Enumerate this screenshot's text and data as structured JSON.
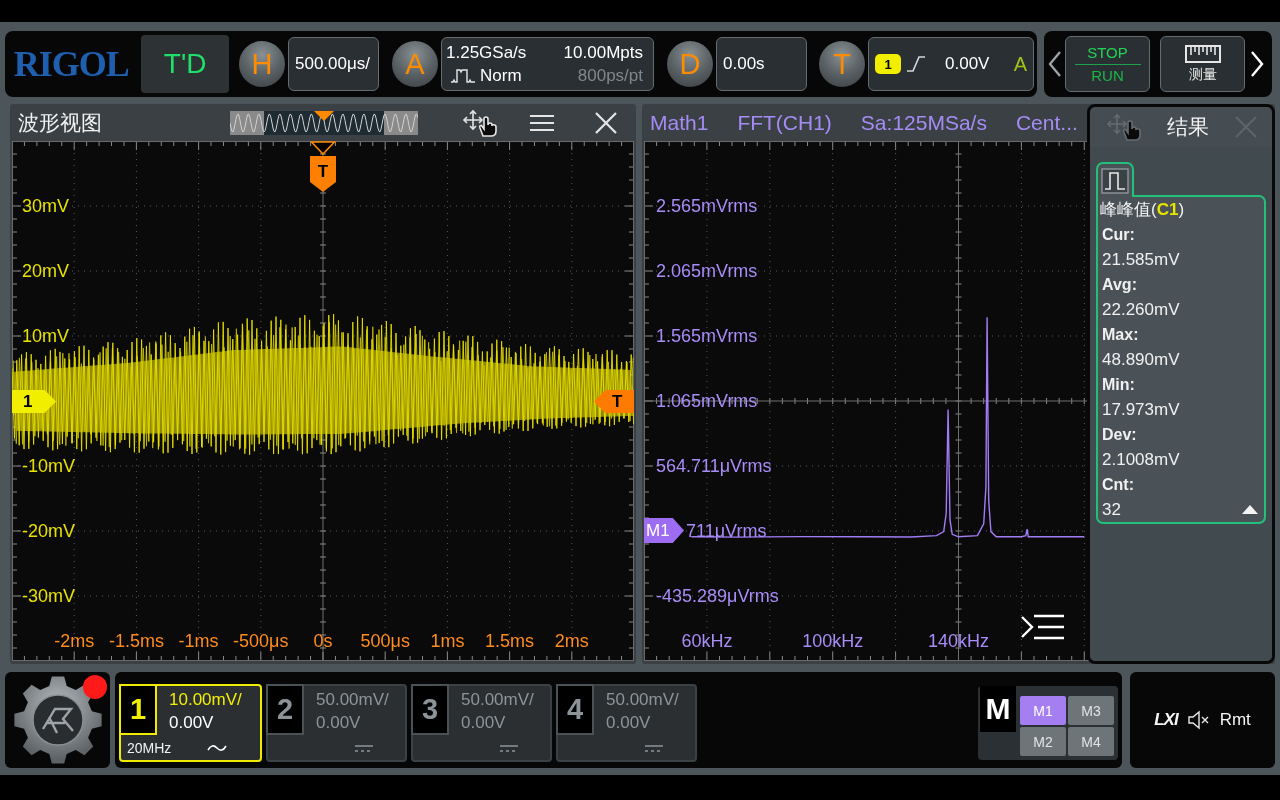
{
  "top_bar": {
    "logo": "RIGOL",
    "mode_button": "T'D",
    "horizontal": {
      "key": "H",
      "scale": "500.00μs/"
    },
    "acquire": {
      "key": "A",
      "sample_rate": "1.25GSa/s",
      "memory_depth": "10.00Mpts",
      "mode": "Norm",
      "resolution": "800ps/pt"
    },
    "delay": {
      "key": "D",
      "value": "0.00s"
    },
    "trigger": {
      "key": "T",
      "source": "1",
      "level": "0.00V",
      "sweep": "A"
    },
    "run_stop": {
      "stop": "STOP",
      "run": "RUN"
    },
    "measure_button": "测量"
  },
  "waveform_view": {
    "title": "波形视图",
    "y_labels_upper": [
      "30mV",
      "20mV",
      "10mV"
    ],
    "y_labels_lower": [
      "-10mV",
      "-20mV",
      "-30mV"
    ],
    "x_labels": [
      "-2ms",
      "-1.5ms",
      "-1ms",
      "-500μs",
      "0s",
      "500μs",
      "1ms",
      "1.5ms",
      "2ms"
    ],
    "channel_marker": "1",
    "trigger_position_marker": "T",
    "trigger_level_marker": "T"
  },
  "fft_view": {
    "header": [
      "Math1",
      "FFT(CH1)",
      "Sa:125MSa/s",
      "Cent..."
    ],
    "math_marker": "M1",
    "y_labels_microvolt": [
      "564.711μVrms",
      "711μVrms",
      "-435.289μVrms"
    ],
    "chart_data": {
      "type": "line",
      "x": [
        55,
        70,
        90,
        110,
        125,
        133,
        135.3,
        136.1,
        136.7,
        137.3,
        138,
        140,
        146,
        148,
        148.7,
        149.1,
        149.6,
        150.3,
        152,
        160,
        161.4,
        161.8,
        162.2,
        180
      ],
      "values": [
        0.02,
        0.018,
        0.022,
        0.02,
        0.019,
        0.03,
        0.06,
        0.2,
        1.0,
        0.15,
        0.04,
        0.02,
        0.03,
        0.12,
        0.4,
        1.71,
        0.3,
        0.06,
        0.02,
        0.02,
        0.03,
        0.08,
        0.02,
        0.02
      ],
      "xlim": [
        40,
        240
      ],
      "ylim": [
        -0.935,
        3.065
      ],
      "grid": true,
      "xticks": [
        {
          "value": 60,
          "label": "60kHz"
        },
        {
          "value": 100,
          "label": "100kHz"
        },
        {
          "value": 140,
          "label": "140kHz"
        }
      ],
      "yticks": [
        {
          "value": 2.565,
          "label": "2.565mVrms"
        },
        {
          "value": 2.065,
          "label": "2.065mVrms"
        },
        {
          "value": 1.565,
          "label": "1.565mVrms"
        },
        {
          "value": 1.065,
          "label": "1.065mVrms"
        }
      ]
    }
  },
  "results_panel": {
    "title": "结果",
    "measurement": "峰峰值(**C1**)",
    "stats": [
      {
        "label": "Cur:",
        "value": "21.585mV"
      },
      {
        "label": "Avg:",
        "value": "22.260mV"
      },
      {
        "label": "Max:",
        "value": "48.890mV"
      },
      {
        "label": "Min:",
        "value": "17.973mV"
      },
      {
        "label": "Dev:",
        "value": "2.1008mV"
      },
      {
        "label": "Cnt:",
        "value": "32"
      }
    ]
  },
  "bottom_bar": {
    "channels": [
      {
        "number": "1",
        "on": true,
        "kind": "ac",
        "scale": "10.00mV/",
        "offset": "0.00V",
        "bandwidth": "20MHz"
      },
      {
        "number": "2",
        "on": false,
        "kind": "dc",
        "scale": "50.00mV/",
        "offset": "0.00V"
      },
      {
        "number": "3",
        "on": false,
        "kind": "dc",
        "scale": "50.00mV/",
        "offset": "0.00V"
      },
      {
        "number": "4",
        "on": false,
        "kind": "dc",
        "scale": "50.00mV/",
        "offset": "0.00V"
      }
    ],
    "math": {
      "label": "M",
      "items": [
        {
          "label": "M1",
          "on": true
        },
        {
          "label": "M3",
          "on": false
        },
        {
          "label": "M2",
          "on": false
        },
        {
          "label": "M4",
          "on": false
        }
      ]
    },
    "status": {
      "lxi": "LXI",
      "sound_muted": true,
      "remote": "Rmt"
    }
  }
}
